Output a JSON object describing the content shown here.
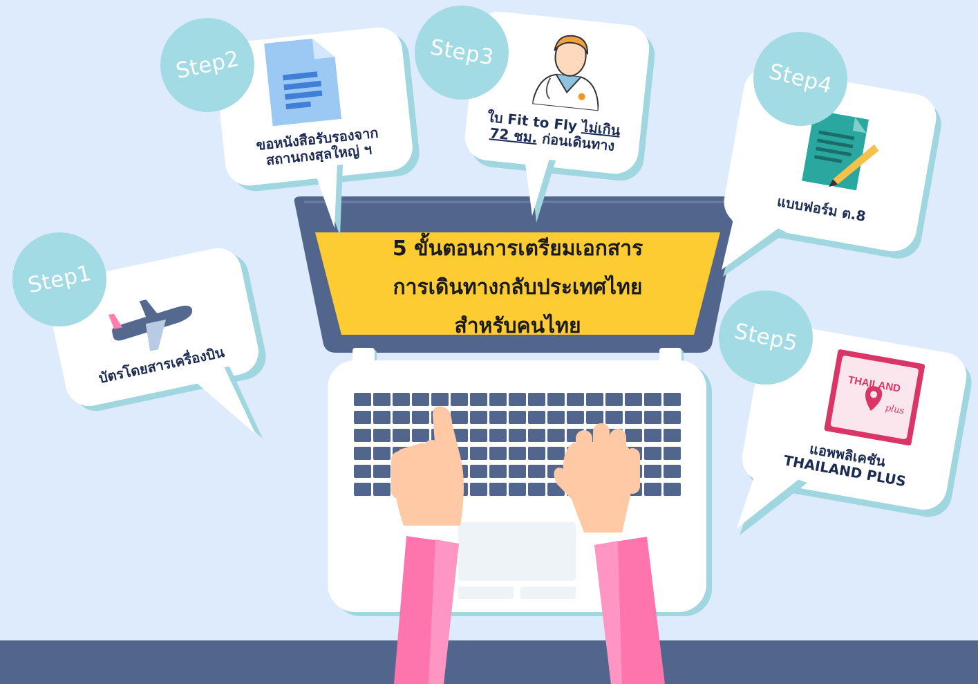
{
  "title": {
    "line1": "5 ขั้นตอนการเตรียมเอกสาร",
    "line2": "การเดินทางกลับประเทศไทย",
    "line3": "สำหรับคนไทย"
  },
  "steps": [
    {
      "badge": "Step1",
      "icon": "airplane-icon",
      "label": "บัตรโดยสารเครื่องบิน"
    },
    {
      "badge": "Step2",
      "icon": "document-icon",
      "label_line1": "ขอหนังสือรับรองจาก",
      "label_line2": "สถานกงสุลใหญ่ ฯ"
    },
    {
      "badge": "Step3",
      "icon": "doctor-icon",
      "label_part1": "ใบ Fit to Fly ",
      "label_part2": "ไม่เกิน",
      "label_part3": "72 ชม.",
      "label_part4": " ก่อนเดินทาง"
    },
    {
      "badge": "Step4",
      "icon": "form-with-pen-icon",
      "label": "แบบฟอร์ม ต.8"
    },
    {
      "badge": "Step5",
      "icon": "thailand-plus-app-icon",
      "label_line1": "แอพพลิเคชัน",
      "label_line2": "THAILAND PLUS",
      "app_logo_text_1": "THAILAND",
      "app_logo_text_2": "plus"
    }
  ],
  "colors": {
    "background": "#deebfc",
    "floor": "#52668d",
    "bubble_shadow": "#9fd6df",
    "step_badge": "#a3dbe4",
    "screen_yellow": "#fdcc33",
    "laptop_frame": "#52668d",
    "sleeve_pink": "#fe74ad",
    "skin": "#ffc9a6"
  }
}
